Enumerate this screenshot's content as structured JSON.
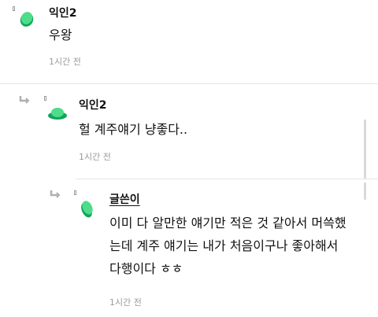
{
  "comments": [
    {
      "nickname": "익인2",
      "body": [
        "우왕"
      ],
      "time": "1시간 전",
      "is_reply": false,
      "avatar_icon": "green-blob-avatar-icon"
    },
    {
      "nickname": "익인2",
      "body": [
        "헐 계주얘기 냥좋다.."
      ],
      "time": "1시간 전",
      "is_reply": true,
      "avatar_icon": "green-flat-avatar-icon"
    },
    {
      "nickname": "글쓴이",
      "body": [
        "이미 다 알만한 얘기만 적은 것 같아서 머쓱했",
        "는데 계주 얘기는 내가 처음이구나 좋아해서",
        "다행이다 ㅎㅎ"
      ],
      "time": "1시간 전",
      "is_reply": true,
      "is_author": true,
      "avatar_icon": "green-leaf-avatar-icon"
    }
  ],
  "colors": {
    "avatar_green_light": "#4ddc8a",
    "avatar_green_dark": "#10a55a",
    "time_gray": "#9a9a9a",
    "divider": "#e6e6e6"
  }
}
